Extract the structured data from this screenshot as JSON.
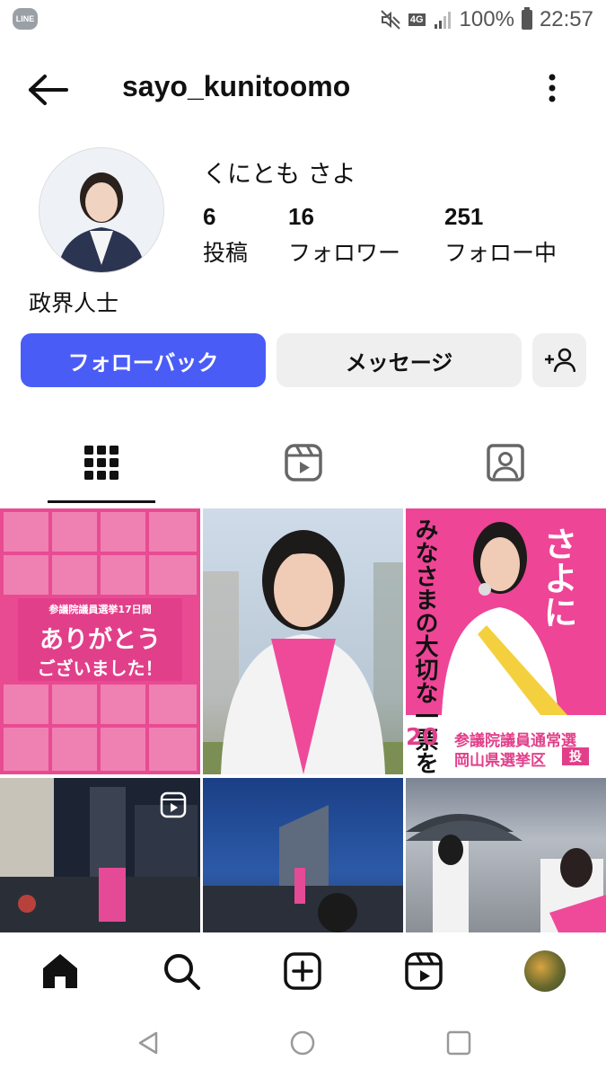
{
  "status_bar": {
    "app_badge": "LINE",
    "network": "4G",
    "battery": "100%",
    "time": "22:57"
  },
  "header": {
    "username": "sayo_kunitoomo"
  },
  "profile": {
    "display_name": "くにとも さよ",
    "category": "政界人士",
    "stats": [
      {
        "value": "6",
        "label": "投稿"
      },
      {
        "value": "16",
        "label": "フォロワー"
      },
      {
        "value": "251",
        "label": "フォロー中"
      }
    ]
  },
  "actions": {
    "follow_back": "フォローバック",
    "message": "メッセージ"
  },
  "tabs": [
    "grid",
    "reels",
    "tagged"
  ],
  "posts": {
    "p1": {
      "line1": "参議院議員選挙17日間",
      "line2": "ありがとう",
      "line3": "ございました！"
    },
    "p3": {
      "headline": "みなさまの大切な一票を",
      "name": "さよに",
      "bottom1": "参議院議員通常選",
      "bottom2": "岡山県選挙区",
      "date": "20",
      "vote": "投"
    }
  },
  "colors": {
    "accent": "#4a5cf6",
    "pink": "#ee4596"
  }
}
